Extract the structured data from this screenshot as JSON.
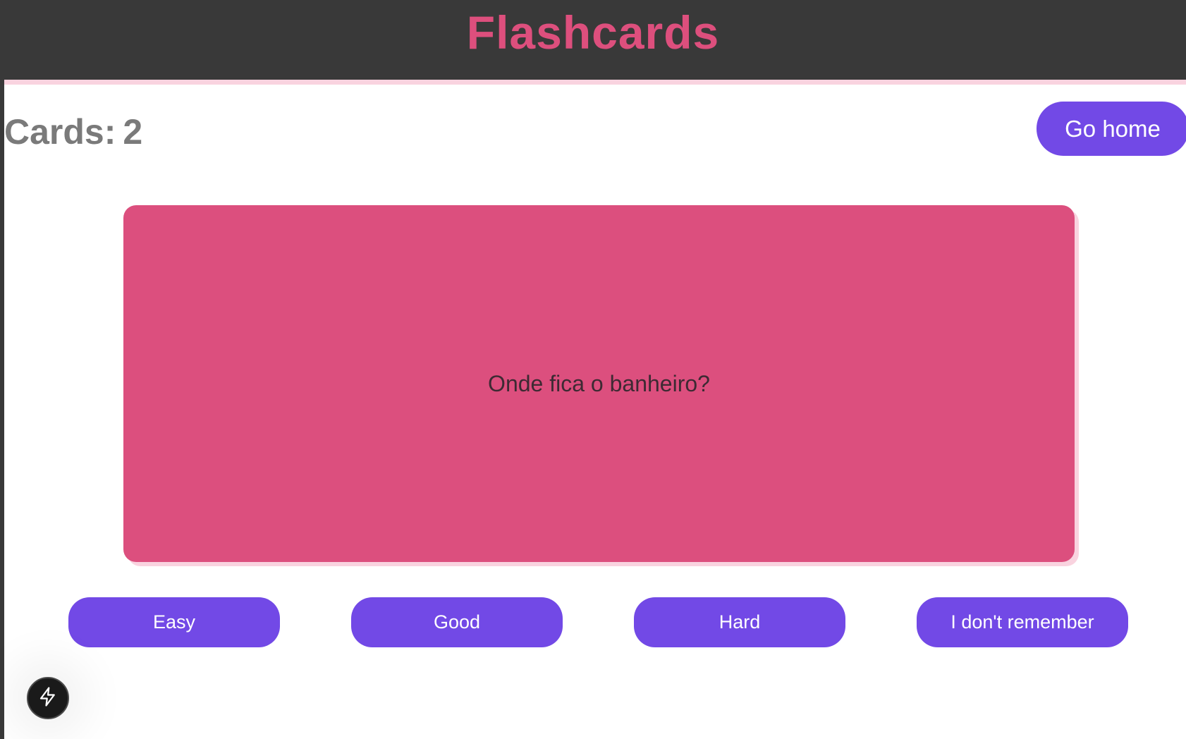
{
  "header": {
    "title": "Flashcards"
  },
  "deck": {
    "cards_label": "Cards:",
    "cards_count": "2"
  },
  "navigation": {
    "go_home_label": "Go home"
  },
  "card": {
    "front_text": "Onde fica o banheiro?"
  },
  "rating_buttons": {
    "easy": "Easy",
    "good": "Good",
    "hard": "Hard",
    "forgot": "I don't remember"
  },
  "dev_indicator": {
    "icon": "lightning-bolt-icon"
  },
  "colors": {
    "header_background": "#393939",
    "title_pink": "#dd4f7d",
    "card_pink": "#dc4f7e",
    "button_purple": "#7249e6",
    "count_gray": "#7a7a7a",
    "stripe_light_pink": "#f9d3df"
  }
}
